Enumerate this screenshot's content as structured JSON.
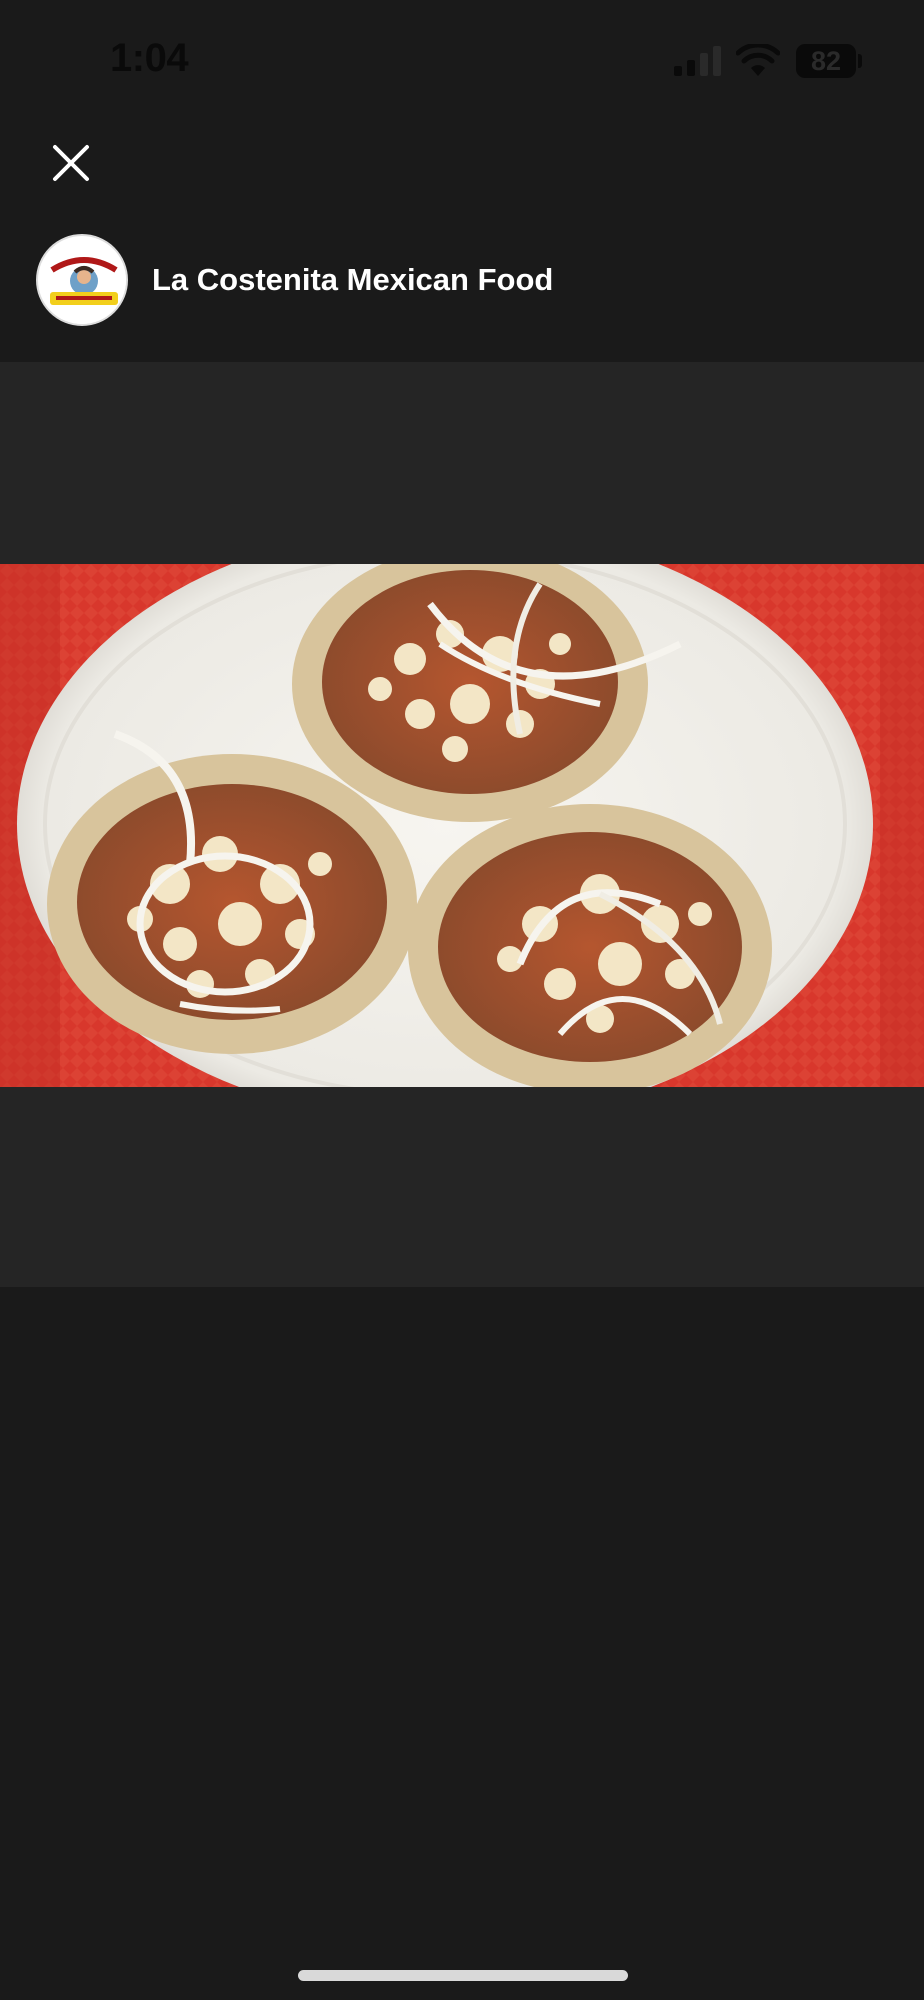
{
  "status_bar": {
    "time": "1:04",
    "battery_level": "82",
    "signal_icon": "cellular-signal-icon",
    "wifi_icon": "wifi-icon"
  },
  "close_icon": "close-icon",
  "store": {
    "name": "La Costenita Mexican Food"
  },
  "photo": {
    "subject": "food-photo"
  },
  "colors": {
    "background": "#1a1a1a",
    "viewer_background": "#252525",
    "text": "#ffffff"
  }
}
